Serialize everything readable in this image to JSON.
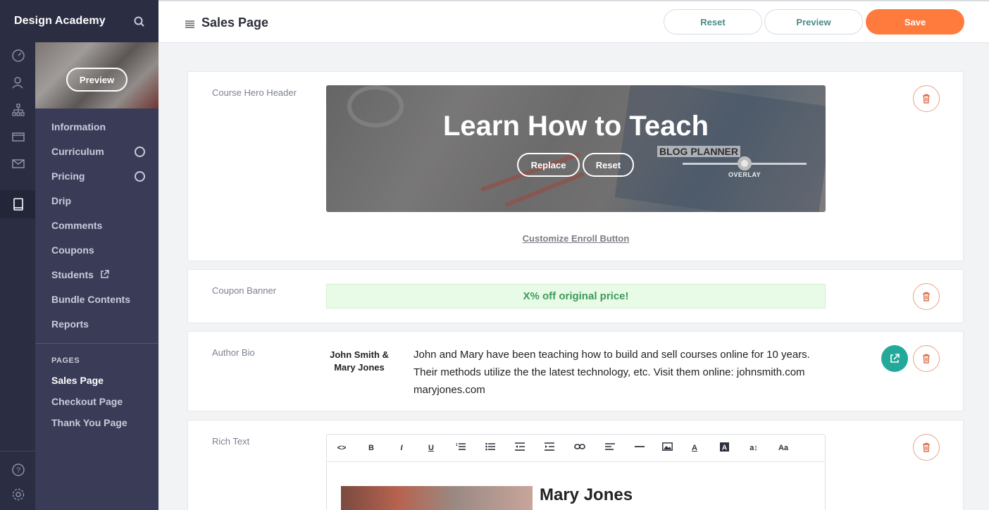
{
  "brand": {
    "name": "Design Academy"
  },
  "thumbnail": {
    "preview_label": "Preview"
  },
  "course_nav": [
    {
      "label": "Information"
    },
    {
      "label": "Curriculum"
    },
    {
      "label": "Pricing"
    },
    {
      "label": "Drip"
    },
    {
      "label": "Comments"
    },
    {
      "label": "Coupons"
    },
    {
      "label": "Students"
    },
    {
      "label": "Bundle Contents"
    },
    {
      "label": "Reports"
    }
  ],
  "pages": {
    "heading": "PAGES",
    "items": [
      {
        "label": "Sales Page",
        "active": true
      },
      {
        "label": "Checkout Page",
        "active": false
      },
      {
        "label": "Thank You Page",
        "active": false
      }
    ]
  },
  "topbar": {
    "title": "Sales Page",
    "reset_label": "Reset",
    "preview_label": "Preview",
    "save_label": "Save",
    "save_color": "#ff7a3d"
  },
  "hero_card": {
    "label": "Course Hero Header",
    "title": "Learn How to Teach",
    "replace_label": "Replace",
    "reset_label": "Reset",
    "overlay_label": "OVERLAY",
    "overlay_level": 0.5,
    "image_text": "BLOG PLANNER",
    "customize_link": "Customize Enroll Button"
  },
  "coupon_card": {
    "label": "Coupon Banner",
    "text": "X% off original price!"
  },
  "author_card": {
    "label": "Author Bio",
    "name_line1": "John Smith &",
    "name_line2": "Mary Jones",
    "bio": "John and Mary have been teaching how to build and sell courses online for 10 years. Their methods utilize the the latest technology, etc. Visit them online: johnsmith.com maryjones.com"
  },
  "richtext_card": {
    "label": "Rich Text",
    "toolbar": [
      "<>",
      "B",
      "I",
      "U",
      "ordered-list-icon",
      "bullet-list-icon",
      "outdent-icon",
      "indent-icon",
      "link-icon",
      "align-icon",
      "hr-icon",
      "image-icon",
      "text-color-icon",
      "bg-color-icon",
      "font-size-icon",
      "Aa"
    ],
    "heading": "Mary Jones"
  },
  "colors": {
    "sidebar": "#2b2d42",
    "panel": "#3a3c57",
    "accent_teal": "#23a99a",
    "delete_red": "#e06c4a",
    "coupon_green": "#3f9a5a"
  }
}
